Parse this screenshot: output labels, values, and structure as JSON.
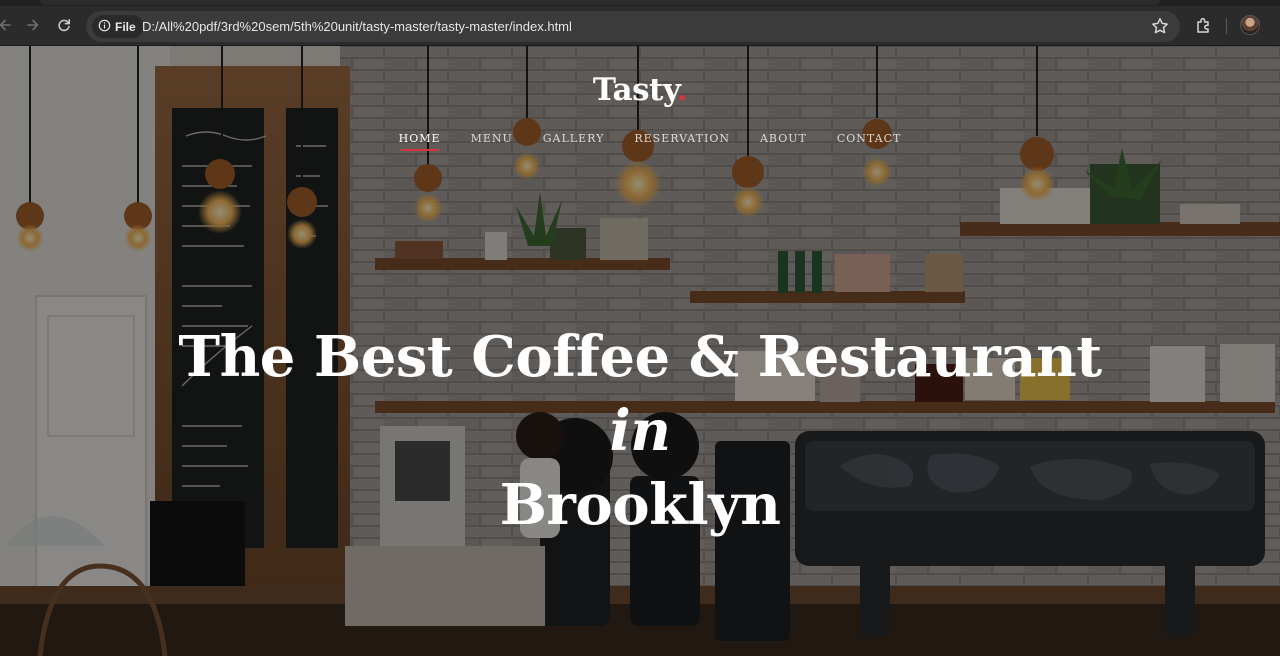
{
  "browser": {
    "security_chip": "File",
    "url": "D:/All%20pdf/3rd%20sem/5th%20unit/tasty-master/tasty-master/index.html"
  },
  "site": {
    "brand": "Tasty",
    "brand_dot": ".",
    "nav": [
      {
        "label": "Home",
        "active": true
      },
      {
        "label": "Menu",
        "active": false
      },
      {
        "label": "Gallery",
        "active": false
      },
      {
        "label": "Reservation",
        "active": false
      },
      {
        "label": "About",
        "active": false
      },
      {
        "label": "Contact",
        "active": false
      }
    ],
    "headline_main": "The Best Coffee & Restaurant",
    "headline_italic": "in",
    "headline_end": "Brooklyn"
  },
  "colors": {
    "accent": "#d8333f",
    "chrome_bg": "#2b2b2b",
    "omnibox_bg": "#3b3b3b"
  }
}
